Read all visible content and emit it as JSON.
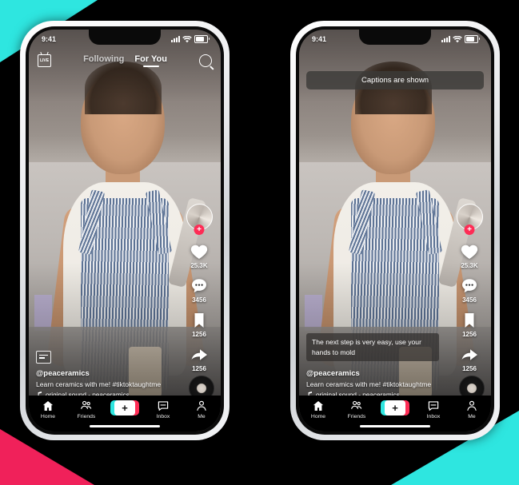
{
  "theme": {
    "accent_cyan": "#2ee6e0",
    "accent_pink": "#fe2c55",
    "background": "#000000",
    "frame": "#e9eaec"
  },
  "status_bar": {
    "time": "9:41",
    "cellular_icon": "signal-bars-icon",
    "wifi_icon": "wifi-icon",
    "battery_icon": "battery-icon"
  },
  "top_nav": {
    "live_label": "LIVE",
    "live_icon": "live-icon",
    "tabs": [
      {
        "label": "Following",
        "active": false
      },
      {
        "label": "For You",
        "active": true
      }
    ],
    "search_icon": "search-icon"
  },
  "toast": {
    "message": "Captions are shown"
  },
  "captions_overlay": {
    "text": "The next step is very easy, use your hands to mold"
  },
  "action_rail": {
    "avatar_icon": "profile-avatar",
    "follow_label": "+",
    "actions": [
      {
        "icon": "heart-icon",
        "count": "25.3K",
        "name": "like"
      },
      {
        "icon": "comment-icon",
        "count": "3456",
        "name": "comment"
      },
      {
        "icon": "bookmark-icon",
        "count": "1256",
        "name": "bookmark"
      },
      {
        "icon": "share-icon",
        "count": "1256",
        "name": "share"
      }
    ]
  },
  "video_meta": {
    "cc_toggle_icon": "captions-toggle-icon",
    "handle": "@peaceramics",
    "description": "Learn ceramics with me! #tiktoktaughtme",
    "music_note_icon": "music-note-icon",
    "sound": "original sound - peaceramics",
    "disc_icon": "spinning-record-icon"
  },
  "bottom_nav": {
    "items": [
      {
        "label": "Home",
        "icon": "home-icon"
      },
      {
        "label": "Friends",
        "icon": "friends-icon"
      },
      {
        "label": "",
        "icon": "create-plus-icon"
      },
      {
        "label": "Inbox",
        "icon": "inbox-icon"
      },
      {
        "label": "Me",
        "icon": "person-icon"
      }
    ],
    "create_label": "+"
  },
  "phones": {
    "left": {
      "name": "captions-off-state",
      "show_toast": false,
      "show_captions": false
    },
    "right": {
      "name": "captions-on-state",
      "show_toast": true,
      "show_captions": true
    }
  }
}
